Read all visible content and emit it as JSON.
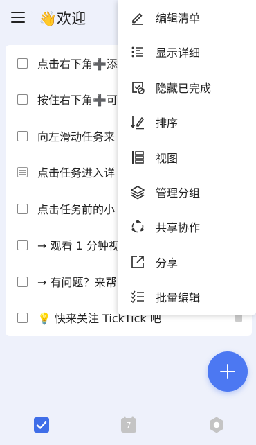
{
  "header": {
    "title": "👋欢迎"
  },
  "tasks": [
    {
      "title": "点击右下角➕添",
      "type": "checkbox"
    },
    {
      "title": "按住右下角➕可",
      "type": "checkbox"
    },
    {
      "title": "向左滑动任务来",
      "type": "checkbox"
    },
    {
      "title": "点击任务进入详",
      "type": "note"
    },
    {
      "title": "点击任务前的小",
      "type": "checkbox"
    },
    {
      "title": "→ 观看 1 分钟视",
      "type": "checkbox"
    },
    {
      "title": "→ 有问题？来帮",
      "type": "checkbox"
    },
    {
      "title": "💡 快来关注 TickTick 吧",
      "type": "checkbox"
    }
  ],
  "menu": {
    "items": [
      {
        "label": "编辑清单",
        "icon": "pencil-icon"
      },
      {
        "label": "显示详细",
        "icon": "list-detail-icon"
      },
      {
        "label": "隐藏已完成",
        "icon": "hide-completed-icon"
      },
      {
        "label": "排序",
        "icon": "sort-icon"
      },
      {
        "label": "视图",
        "icon": "view-icon"
      },
      {
        "label": "管理分组",
        "icon": "layers-icon"
      },
      {
        "label": "共享协作",
        "icon": "share-collab-icon"
      },
      {
        "label": "分享",
        "icon": "share-icon"
      },
      {
        "label": "批量编辑",
        "icon": "batch-edit-icon"
      }
    ]
  },
  "bottom_nav": {
    "calendar_day": "7",
    "active_color": "#3f6ee8",
    "inactive_color": "#c4c4c4"
  },
  "colors": {
    "accent": "#4c78f2",
    "background": "#eef1fb"
  }
}
